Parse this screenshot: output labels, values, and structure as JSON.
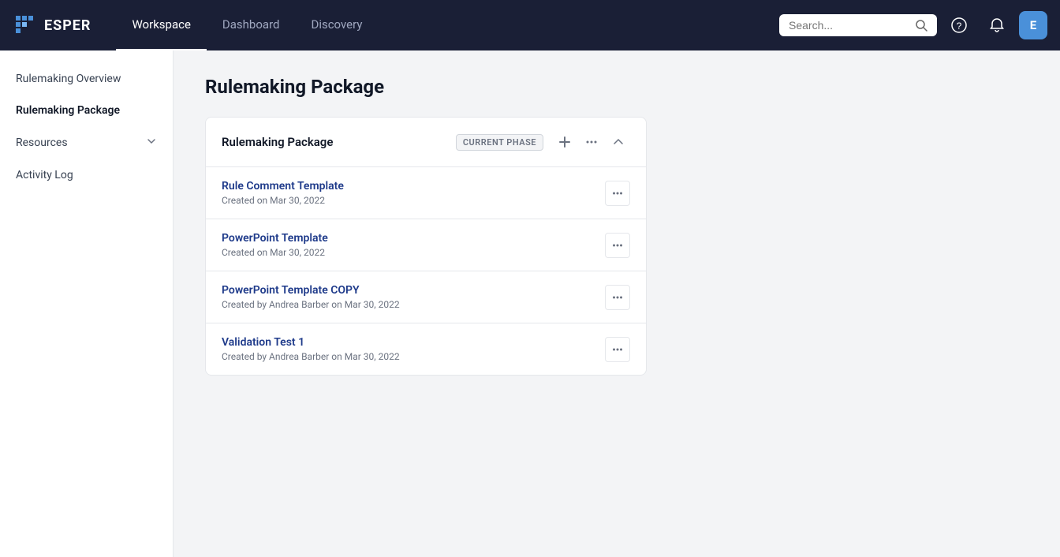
{
  "brand": {
    "name": "ESPER"
  },
  "nav": {
    "links": [
      {
        "id": "workspace",
        "label": "Workspace",
        "active": true
      },
      {
        "id": "dashboard",
        "label": "Dashboard",
        "active": false
      },
      {
        "id": "discovery",
        "label": "Discovery",
        "active": false
      }
    ],
    "search_placeholder": "Search...",
    "user_initial": "E"
  },
  "sidebar": {
    "items": [
      {
        "id": "rulemaking-overview",
        "label": "Rulemaking Overview",
        "active": false,
        "has_chevron": false
      },
      {
        "id": "rulemaking-package",
        "label": "Rulemaking Package",
        "active": true,
        "has_chevron": false
      },
      {
        "id": "resources",
        "label": "Resources",
        "active": false,
        "has_chevron": true
      },
      {
        "id": "activity-log",
        "label": "Activity Log",
        "active": false,
        "has_chevron": false
      }
    ]
  },
  "page": {
    "title": "Rulemaking Package"
  },
  "card": {
    "header": {
      "title": "Rulemaking Package",
      "phase_badge": "CURRENT PHASE"
    },
    "items": [
      {
        "id": "rule-comment-template",
        "title": "Rule Comment Template",
        "meta": "Created on Mar 30, 2022"
      },
      {
        "id": "powerpoint-template",
        "title": "PowerPoint Template",
        "meta": "Created on Mar 30, 2022"
      },
      {
        "id": "powerpoint-template-copy",
        "title": "PowerPoint Template COPY",
        "meta": "Created by Andrea Barber on Mar 30, 2022"
      },
      {
        "id": "validation-test-1",
        "title": "Validation Test 1",
        "meta": "Created by Andrea Barber on Mar 30, 2022"
      }
    ]
  }
}
